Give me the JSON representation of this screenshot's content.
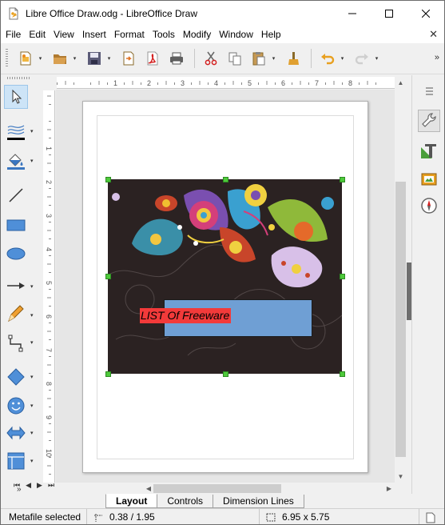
{
  "window": {
    "title": "Libre Office Draw.odg - LibreOffice Draw",
    "minimize_icon": "minimize-icon",
    "maximize_icon": "maximize-icon",
    "close_icon": "close-icon"
  },
  "menu": {
    "items": [
      "File",
      "Edit",
      "View",
      "Insert",
      "Format",
      "Tools",
      "Modify",
      "Window",
      "Help"
    ],
    "close_doc_icon": "close-document-icon"
  },
  "toolbar": {
    "buttons": [
      "new-icon",
      "open-icon",
      "save-icon",
      "export-icon",
      "export-pdf-icon",
      "print-icon",
      "cut-icon",
      "copy-icon",
      "paste-icon",
      "clone-formatting-icon",
      "undo-icon",
      "redo-icon"
    ],
    "more_label": "»"
  },
  "drawing_toolbar": {
    "tools": [
      "select-icon",
      "line-color-icon",
      "fill-color-icon",
      "line-icon",
      "rectangle-icon",
      "ellipse-icon",
      "arrow-line-icon",
      "curve-icon",
      "connector-icon",
      "basic-shapes-icon",
      "symbol-shapes-icon",
      "block-arrows-icon",
      "flowchart-icon"
    ],
    "more_label": "»"
  },
  "sidebar": {
    "items": [
      "sidebar-menu-icon",
      "properties-icon",
      "styles-icon",
      "gallery-icon",
      "navigator-icon"
    ]
  },
  "ruler": {
    "h_labels": [
      "1",
      "2",
      "3",
      "4",
      "5",
      "6",
      "7",
      "8"
    ],
    "v_labels": [
      "1",
      "2",
      "3",
      "4",
      "5",
      "6",
      "7",
      "8",
      "9",
      "10"
    ]
  },
  "document": {
    "text_box": "LIST Of Freeware"
  },
  "tabs": {
    "items": [
      "Layout",
      "Controls",
      "Dimension Lines"
    ],
    "active": "Layout"
  },
  "status": {
    "selection": "Metafile selected",
    "position": "0.38 / 1.95",
    "size": "6.95 x 5.75"
  },
  "colors": {
    "accent": "#4ec93b",
    "image_background": "#2b2222",
    "text_highlight": "#f23a3a",
    "blue_rect": "#6f9fd4"
  }
}
